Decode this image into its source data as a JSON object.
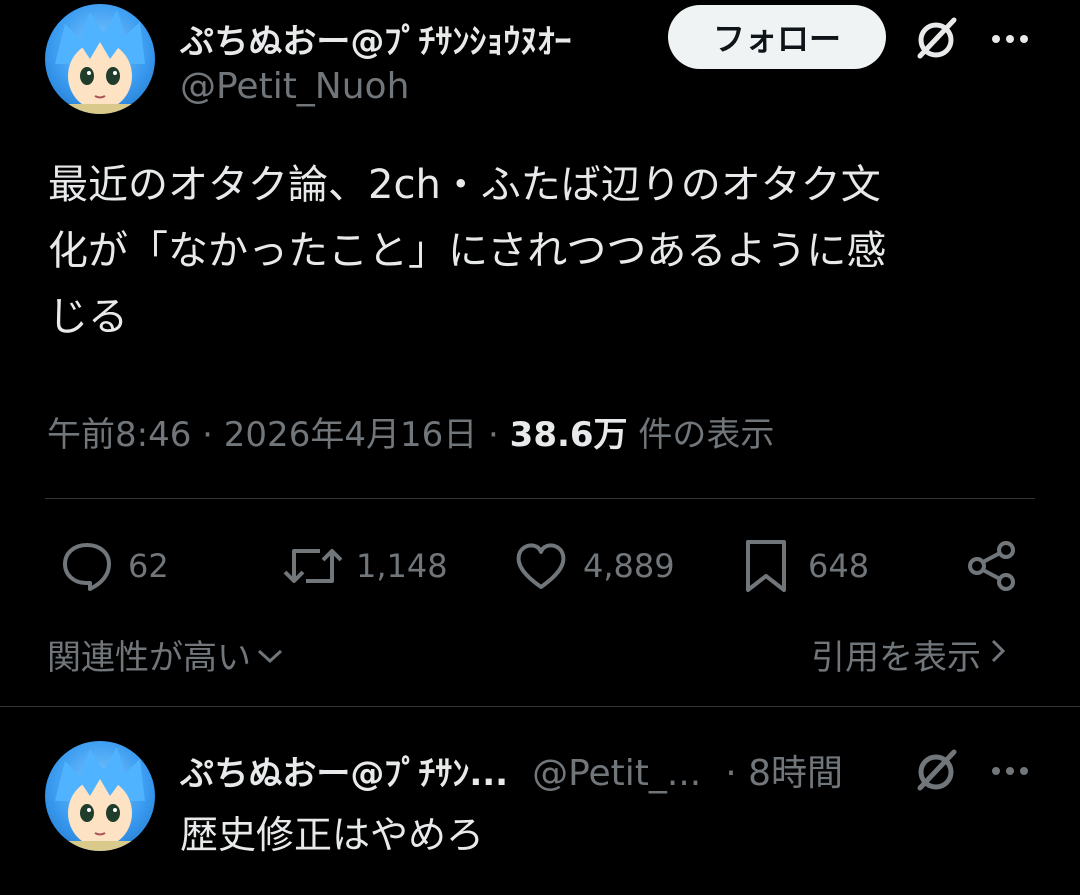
{
  "tweet": {
    "display_name": "ぷちぬおー@ﾌﾟﾁｻﾝｼｮｳﾇｵｰ",
    "handle": "@Petit_Nuoh",
    "follow_label": "フォロー",
    "text_lines": [
      "最近のオタク論、2ch・ふたば辺りのオタク文",
      "化が「なかったこと」にされつつあるように感",
      "じる"
    ],
    "time": "午前8:46",
    "date": "2026年4月16日",
    "views_count": "38.6万",
    "views_label": "件の表示",
    "sep": "·"
  },
  "actions": {
    "replies": "62",
    "retweets": "1,148",
    "likes": "4,889",
    "bookmarks": "648"
  },
  "sort": {
    "label": "関連性が高い",
    "quotes_label": "引用を表示"
  },
  "reply": {
    "display_name": "ぷちぬおー@ﾌﾟﾁｻﾝ...",
    "handle": "@Petit_...",
    "time": "· 8時間",
    "text": "歴史修正はやめろ"
  },
  "icons": [
    "avatar",
    "grok-icon",
    "more-icon",
    "reply-icon",
    "retweet-icon",
    "like-icon",
    "bookmark-icon",
    "share-icon",
    "chevron-down-icon",
    "chevron-right-icon"
  ],
  "colors": {
    "background": "#000000",
    "text": "#e7e9ea",
    "muted": "#71767b",
    "divider": "#2f3336",
    "follow_bg": "#eff3f4"
  }
}
